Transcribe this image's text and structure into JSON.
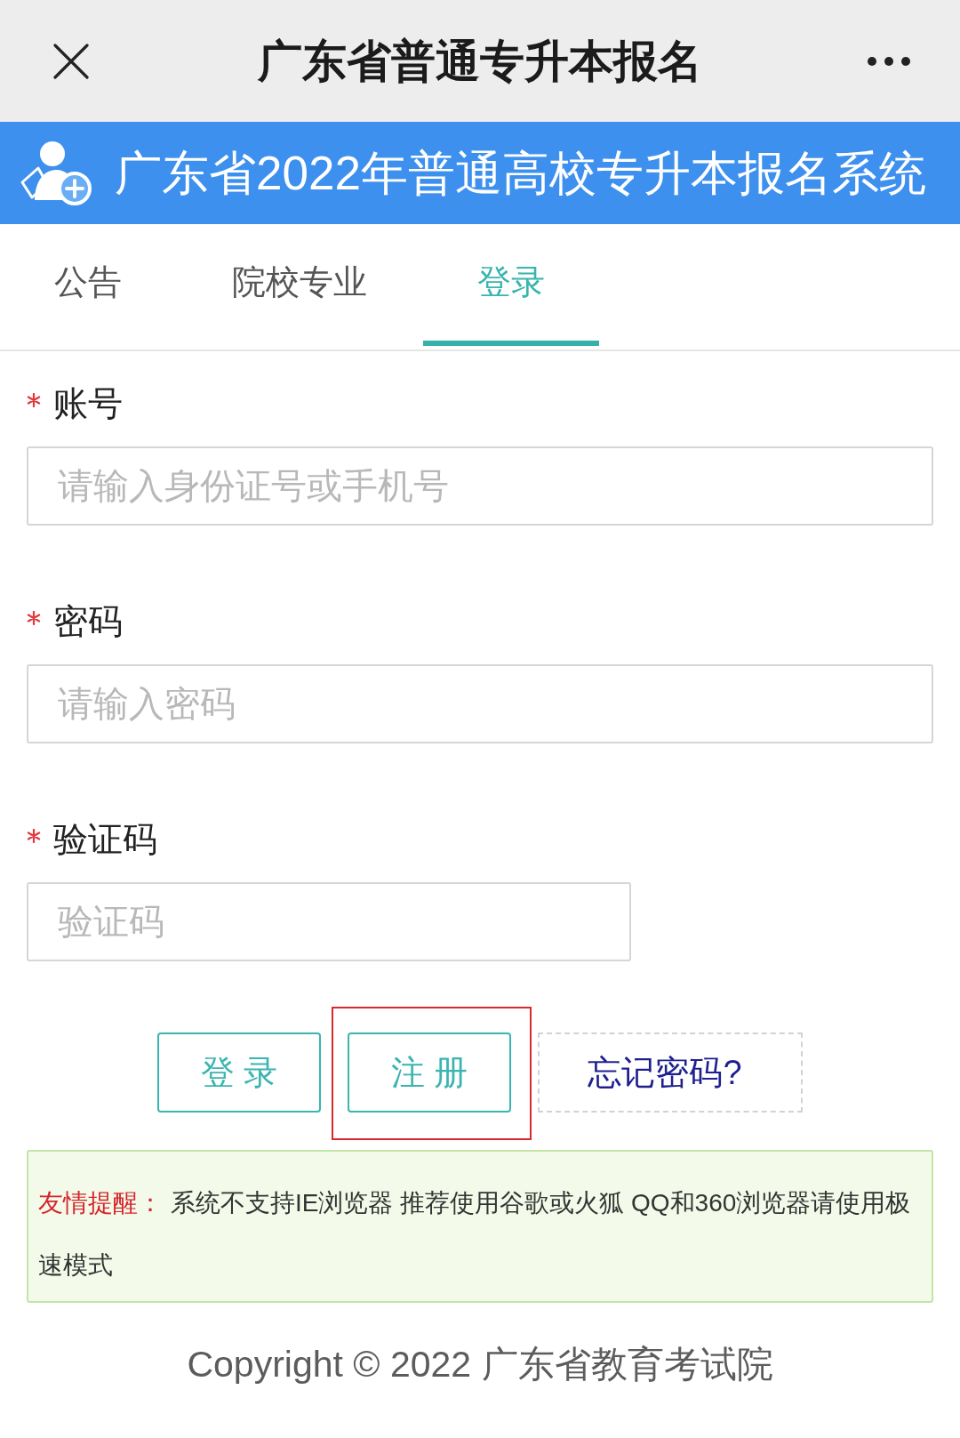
{
  "top_bar": {
    "title": "广东省普通专升本报名"
  },
  "banner": {
    "title": "广东省2022年普通高校专升本报名系统"
  },
  "tabs": [
    {
      "label": "公告",
      "selected": false
    },
    {
      "label": "院校专业",
      "selected": false
    },
    {
      "label": "登录",
      "selected": true
    }
  ],
  "form": {
    "fields": [
      {
        "label": "账号",
        "required": true,
        "kind": "text",
        "placeholder": "请输入身份证号或手机号"
      },
      {
        "label": "密码",
        "required": true,
        "kind": "password",
        "placeholder": "请输入密码"
      },
      {
        "label": "验证码",
        "required": true,
        "kind": "captcha",
        "placeholder": "验证码"
      }
    ]
  },
  "buttons": [
    {
      "label": "登 录",
      "kind": "outline",
      "highlighted": false
    },
    {
      "label": "注 册",
      "kind": "outline",
      "highlighted": true
    },
    {
      "label": "忘记密码?",
      "kind": "dashed",
      "highlighted": false
    }
  ],
  "notice": {
    "label": "友情提醒：",
    "text": "系统不支持IE浏览器 推荐使用谷歌或火狐 QQ和360浏览器请使用极速模式"
  },
  "footer": {
    "copyright": "Copyright © 2022 广东省教育考试院"
  }
}
